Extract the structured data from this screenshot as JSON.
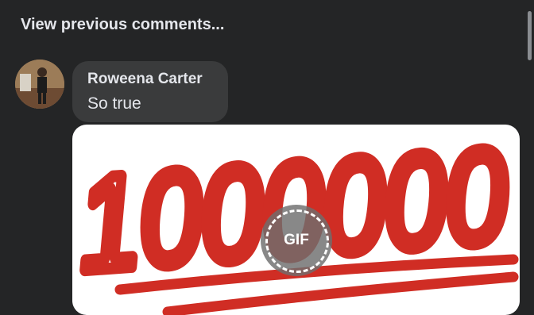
{
  "comments": {
    "view_previous": "View previous comments..."
  },
  "comment": {
    "author": "Roweena Carter",
    "text": "So true"
  },
  "gif": {
    "badge_label": "GIF",
    "artwork_text": "1000000"
  },
  "colors": {
    "background": "#242526",
    "bubble": "#3a3b3c",
    "text": "#e4e6eb",
    "artwork_red": "#d02d24"
  },
  "icons": {
    "gif_badge": "gif-play-badge-icon"
  }
}
